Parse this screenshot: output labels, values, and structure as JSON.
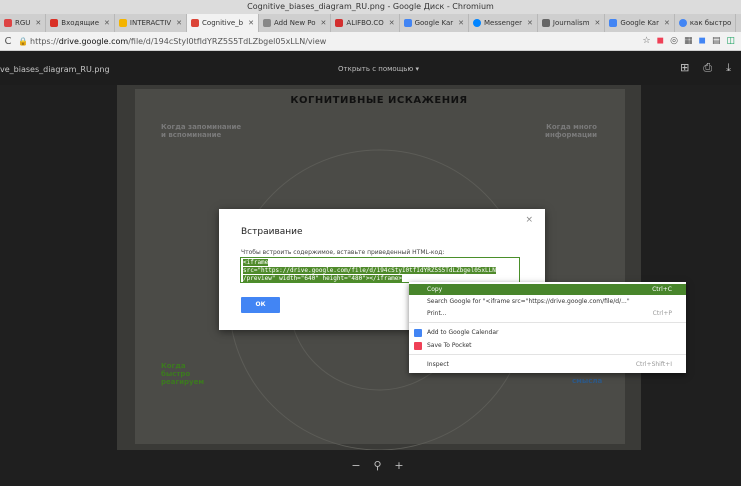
{
  "window": {
    "title": "Cognitive_biases_diagram_RU.png - Google Диск - Chromium"
  },
  "tabs": [
    {
      "label": "RGU",
      "color": "#d44"
    },
    {
      "label": "Входящие",
      "color": "#d93025"
    },
    {
      "label": "INTERACTIV",
      "color": "#f4b400"
    },
    {
      "label": "Cognitive_b",
      "color": "#db4437",
      "active": true
    },
    {
      "label": "Add New Po",
      "color": "#888"
    },
    {
      "label": "ALIFBO.CO",
      "color": "#d32f2f"
    },
    {
      "label": "Google Kar",
      "color": "#4285f4"
    },
    {
      "label": "Messenger",
      "color": "#0084ff"
    },
    {
      "label": "Journalism",
      "color": "#666"
    },
    {
      "label": "Google Kar",
      "color": "#4285f4"
    },
    {
      "label": "как быстро",
      "color": "#4285f4"
    }
  ],
  "address": {
    "scheme": "https://",
    "host": "drive.google.com",
    "path": "/file/d/194cStyI0tfIdYRZ5S5TdLZbgel05xLLN/view"
  },
  "viewer": {
    "filename": "ve_biases_diagram_RU.png",
    "open_with": "Открыть с помощью ▾"
  },
  "diagram": {
    "title": "КОГНИТИВНЫЕ ИСКАЖЕНИЯ",
    "left_top": "Когда запоминание\nи вспоминание",
    "right_top": "Когда много\nинформации",
    "left_bottom": "Когда\nбыстро\nреагируем",
    "right_bottom": "смысла"
  },
  "dialog": {
    "title": "Встраивание",
    "hint": "Чтобы встроить содержимое, вставьте приведенный HTML-код:",
    "code_lines": [
      "<iframe",
      "src=\"https://drive.google.com/file/d/194cStyI0tfIdYRZ5S5TdLZbgel05xLLN",
      "/preview\" width=\"640\" height=\"480\"></iframe>"
    ],
    "ok_label": "ОК",
    "close_label": "×"
  },
  "context_menu": {
    "items": [
      {
        "label": "Copy",
        "shortcut": "Ctrl+C",
        "hover": true
      },
      {
        "label": "Search Google for \"<iframe src=\"https://drive.google.com/file/d/...\"",
        "shortcut": ""
      },
      {
        "label": "Print...",
        "shortcut": "Ctrl+P"
      },
      {
        "label": "Add to Google Calendar",
        "shortcut": "",
        "icon_color": "#4285f4"
      },
      {
        "label": "Save To Pocket",
        "shortcut": "",
        "icon_color": "#ef4056"
      },
      {
        "label": "Inspect",
        "shortcut": "Ctrl+Shift+I"
      }
    ]
  },
  "zoom": {
    "minus": "−",
    "zoom_icon": "🔍",
    "plus": "+"
  }
}
